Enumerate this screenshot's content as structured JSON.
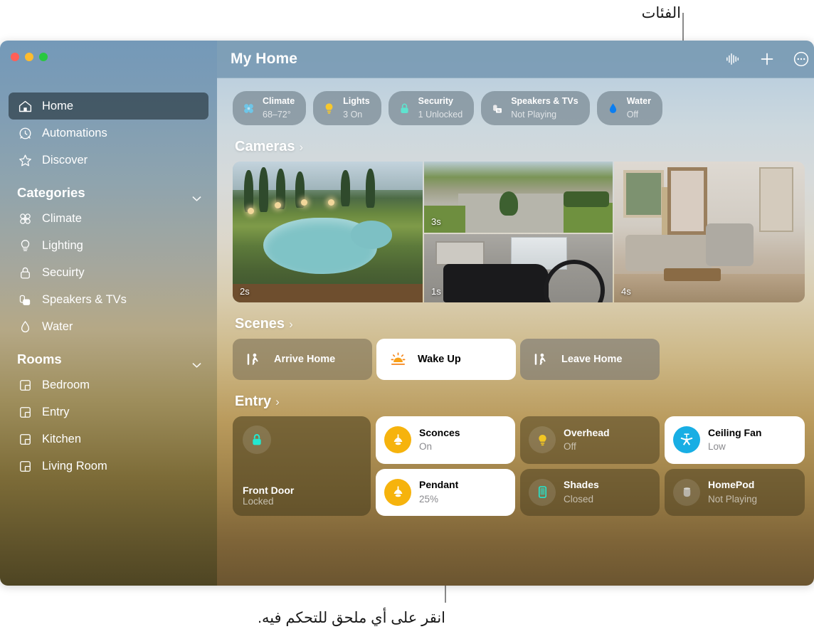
{
  "callouts": {
    "top": "الفئات",
    "bottom": "انقر على أي ملحق للتحكم فيه."
  },
  "window": {
    "title": "My Home",
    "toolbar": [
      {
        "name": "waveform-icon",
        "label": "Waveform"
      },
      {
        "name": "add-icon",
        "label": "Add"
      },
      {
        "name": "more-icon",
        "label": "More"
      }
    ]
  },
  "sidebar": {
    "top_items": [
      {
        "label": "Home",
        "icon": "house-icon",
        "selected": true
      },
      {
        "label": "Automations",
        "icon": "clock-icon",
        "selected": false
      },
      {
        "label": "Discover",
        "icon": "star-icon",
        "selected": false
      }
    ],
    "categories_header": "Categories",
    "categories": [
      {
        "label": "Climate",
        "icon": "fan-icon"
      },
      {
        "label": "Lighting",
        "icon": "bulb-icon"
      },
      {
        "label": "Secuirty",
        "icon": "lock-icon"
      },
      {
        "label": "Speakers & TVs",
        "icon": "speaker-tv-icon"
      },
      {
        "label": "Water",
        "icon": "droplet-icon"
      }
    ],
    "rooms_header": "Rooms",
    "rooms": [
      {
        "label": "Bedroom",
        "icon": "room-icon"
      },
      {
        "label": "Entry",
        "icon": "room-icon"
      },
      {
        "label": "Kitchen",
        "icon": "room-icon"
      },
      {
        "label": "Living Room",
        "icon": "room-icon"
      }
    ]
  },
  "status_pills": [
    {
      "name": "Climate",
      "status": "68–72°",
      "icon": "fan-icon",
      "color": "#6ec6e8"
    },
    {
      "name": "Lights",
      "status": "3 On",
      "icon": "bulb-icon",
      "color": "#f7c82c"
    },
    {
      "name": "Security",
      "status": "1 Unlocked",
      "icon": "lock-icon",
      "color": "#5fe3cf"
    },
    {
      "name": "Speakers & TVs",
      "status": "Not Playing",
      "icon": "speaker-tv-icon",
      "color": "#e9e9ea"
    },
    {
      "name": "Water",
      "status": "Off",
      "icon": "droplet-icon",
      "color": "#0c7ef0"
    }
  ],
  "sections": {
    "cameras": "Cameras",
    "scenes": "Scenes",
    "entry": "Entry",
    "arrow": "›"
  },
  "cameras": [
    {
      "name": "pool-camera",
      "timestamp": "2s"
    },
    {
      "name": "driveway-camera",
      "timestamp": "3s"
    },
    {
      "name": "garage-camera",
      "timestamp": "1s"
    },
    {
      "name": "living-room-camera",
      "timestamp": "4s"
    }
  ],
  "scenes": [
    {
      "label": "Arrive Home",
      "icon": "walk-in-icon",
      "active": false,
      "variant": "warm"
    },
    {
      "label": "Wake Up",
      "icon": "sunrise-icon",
      "active": true,
      "variant": "white"
    },
    {
      "label": "Leave Home",
      "icon": "walk-out-icon",
      "active": false,
      "variant": "gray"
    }
  ],
  "entry_accessories": {
    "front_door": {
      "name": "Front Door",
      "status": "Locked",
      "icon": "lock-icon",
      "on": false
    },
    "tiles": [
      {
        "name": "Sconces",
        "status": "On",
        "icon": "pendant-light-icon",
        "on": true,
        "kind": "light"
      },
      {
        "name": "Pendant",
        "status": "25%",
        "icon": "pendant-light-icon",
        "on": true,
        "kind": "light"
      },
      {
        "name": "Overhead",
        "status": "Off",
        "icon": "bulb-icon",
        "on": false,
        "kind": "light"
      },
      {
        "name": "Shades",
        "status": "Closed",
        "icon": "shade-icon",
        "on": false,
        "kind": "shade"
      },
      {
        "name": "Ceiling Fan",
        "status": "Low",
        "icon": "fan-icon",
        "on": true,
        "kind": "fan"
      },
      {
        "name": "HomePod",
        "status": "Not Playing",
        "icon": "homepod-icon",
        "on": false,
        "kind": "speaker"
      }
    ]
  }
}
